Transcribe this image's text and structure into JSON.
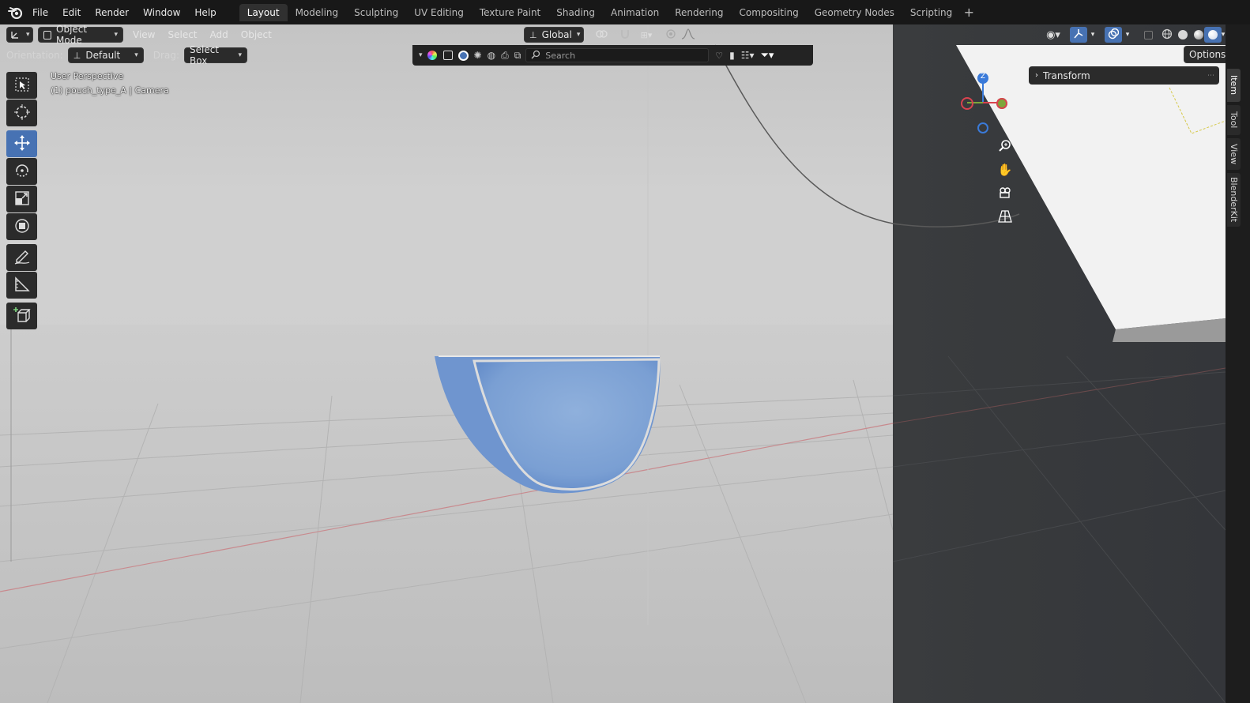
{
  "menu": {
    "items": [
      "File",
      "Edit",
      "Render",
      "Window",
      "Help"
    ]
  },
  "workspaces": {
    "tabs": [
      "Layout",
      "Modeling",
      "Sculpting",
      "UV Editing",
      "Texture Paint",
      "Shading",
      "Animation",
      "Rendering",
      "Compositing",
      "Geometry Nodes",
      "Scripting"
    ],
    "active": "Layout"
  },
  "header": {
    "mode": "Object Mode",
    "menus": [
      "View",
      "Select",
      "Add",
      "Object"
    ],
    "transform_orientation": "Global"
  },
  "header2": {
    "orientation_label": "Orientation:",
    "orientation_value": "Default",
    "drag_label": "Drag:",
    "drag_value": "Select Box",
    "search_placeholder": "Search",
    "options_label": "Options"
  },
  "viewport": {
    "perspective_label": "User Perspective",
    "object_label": "(1) pouch_type_A | Camera",
    "gizmo_axis_label": "Z"
  },
  "npanel": {
    "transform_label": "Transform",
    "tabs": [
      "Item",
      "Tool",
      "View",
      "BlenderKit"
    ],
    "active_tab": "Item"
  },
  "colors": {
    "accent": "#4772b3",
    "object": "#86a8d6",
    "axis_x": "#d9434f",
    "axis_y": "#7ea63a",
    "axis_z": "#3a7ad9"
  }
}
